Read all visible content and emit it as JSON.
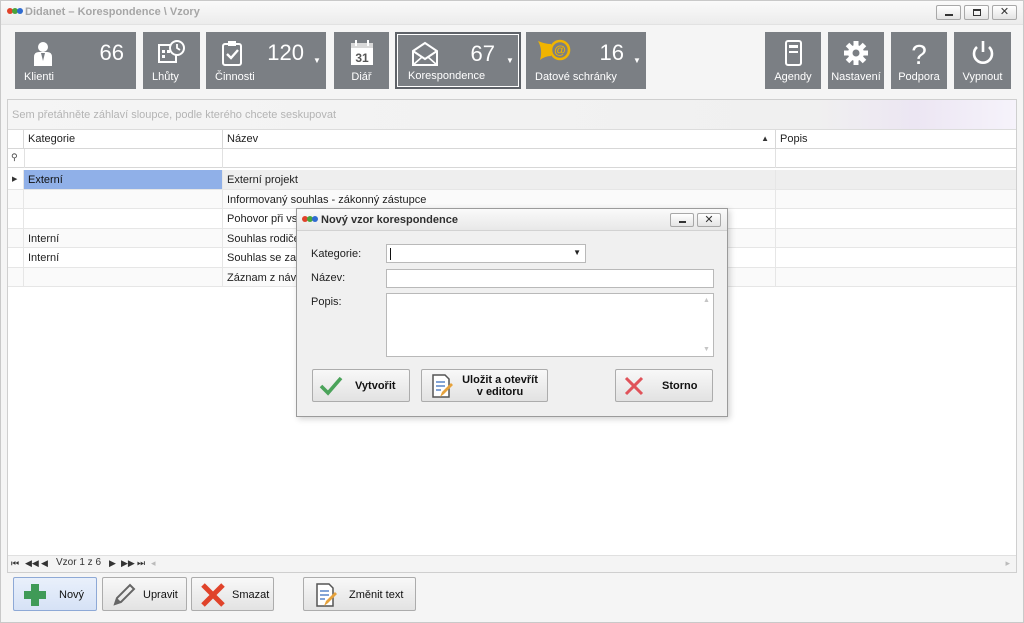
{
  "window": {
    "title": "Didanet – Korespondence \\ Vzory"
  },
  "toolbar": {
    "tiles": [
      {
        "key": "klienti",
        "label": "Klienti",
        "count": "66",
        "icon": "person-icon"
      },
      {
        "key": "lhuty",
        "label": "Lhůty",
        "icon": "calendar-clock-icon"
      },
      {
        "key": "cinnosti",
        "label": "Činnosti",
        "count": "120",
        "icon": "clipboard-check-icon"
      },
      {
        "key": "diar",
        "label": "Diář",
        "icon": "calendar-31-icon",
        "calendar_day": "31"
      },
      {
        "key": "korespondence",
        "label": "Korespondence",
        "count": "67",
        "icon": "envelope-icon"
      },
      {
        "key": "datove",
        "label": "Datové schránky",
        "count": "16",
        "icon": "horn-at-icon"
      }
    ],
    "right_tiles": [
      {
        "key": "agendy",
        "label": "Agendy",
        "icon": "binder-icon"
      },
      {
        "key": "nastaveni",
        "label": "Nastavení",
        "icon": "gear-icon"
      },
      {
        "key": "podpora",
        "label": "Podpora",
        "icon": "question-icon"
      },
      {
        "key": "vypnout",
        "label": "Vypnout",
        "icon": "power-icon"
      }
    ]
  },
  "grid": {
    "group_hint": "Sem přetáhněte záhlaví sloupce, podle kterého chcete seskupovat",
    "columns": [
      "Kategorie",
      "Název",
      "Popis"
    ],
    "rows": [
      {
        "kategorie": "Externí",
        "nazev": "Externí projekt",
        "popis": ""
      },
      {
        "kategorie": "",
        "nazev": "Informovaný souhlas - zákonný zástupce",
        "popis": ""
      },
      {
        "kategorie": "",
        "nazev": "Pohovor při vstupu",
        "popis": ""
      },
      {
        "kategorie": "Interní",
        "nazev": "Souhlas rodiče s",
        "popis": ""
      },
      {
        "kategorie": "Interní",
        "nazev": "Souhlas se zasíl",
        "popis": ""
      },
      {
        "kategorie": "",
        "nazev": "Záznam z návště",
        "popis": ""
      }
    ],
    "pager_text": "Vzor 1 z 6"
  },
  "actions": {
    "new": "Nový",
    "edit": "Upravit",
    "delete": "Smazat",
    "change_text": "Změnit text"
  },
  "dialog": {
    "title": "Nový vzor korespondence",
    "kategorie_label": "Kategorie:",
    "kategorie_value": "",
    "nazev_label": "Název:",
    "nazev_value": "",
    "popis_label": "Popis:",
    "popis_value": "",
    "create_button": "Vytvořit",
    "save_open_line1": "Uložit a otevřít",
    "save_open_line2": "v editoru",
    "cancel_button": "Storno"
  },
  "colors": {
    "tile_bg": "#7b7f84",
    "selection": "#90b0e8",
    "logo_red": "#e0432a",
    "logo_green": "#49a53c",
    "logo_blue": "#2f6bd1"
  }
}
